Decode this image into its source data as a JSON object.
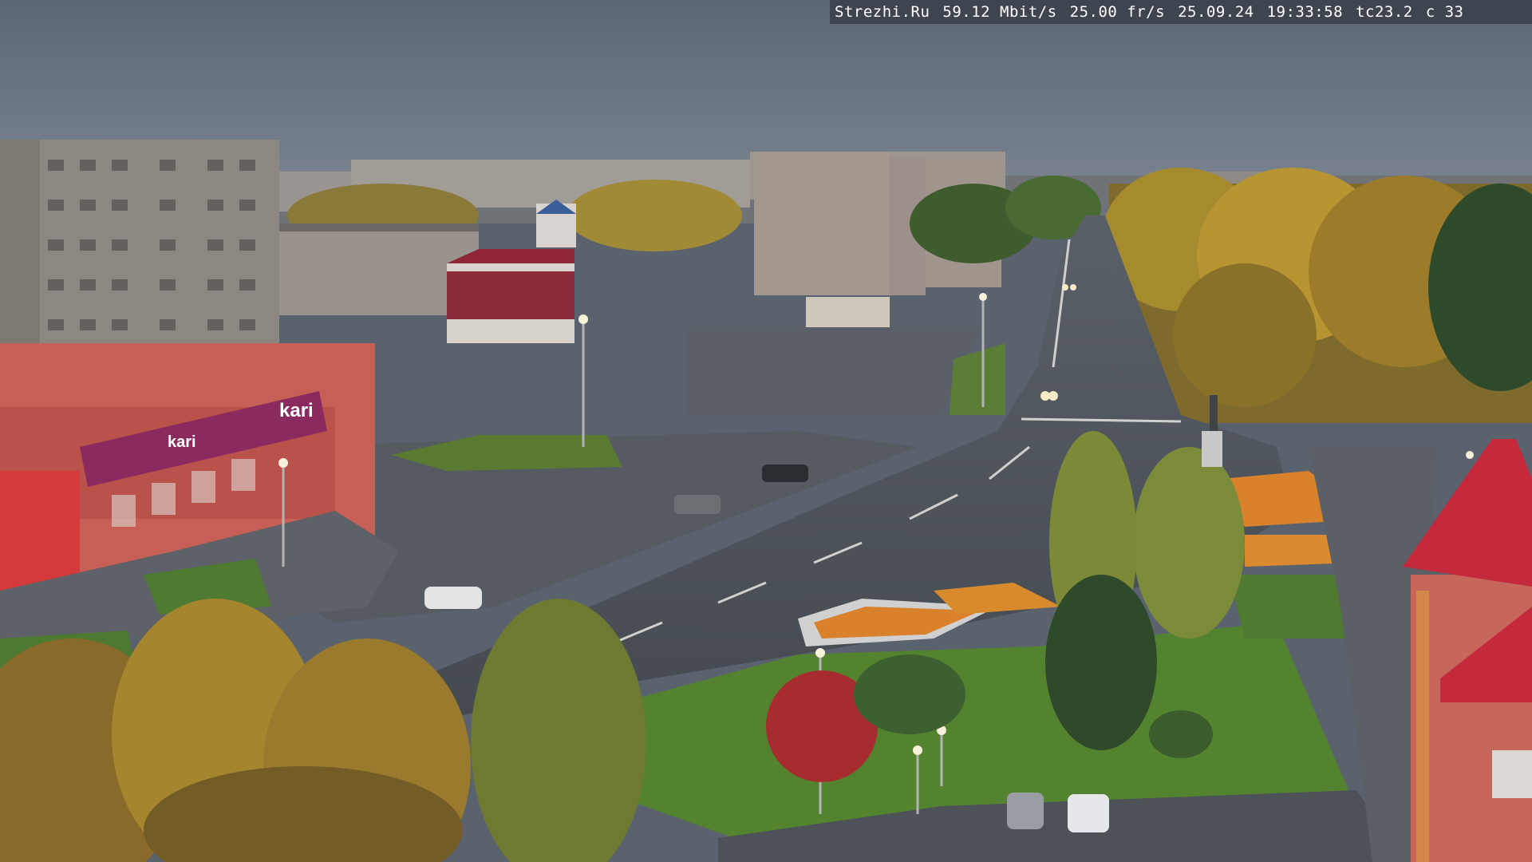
{
  "overlay": {
    "site": "Strezhi.Ru",
    "bitrate": "59.12 Mbit/s",
    "framerate": "25.00 fr/s",
    "date": "25.09.24",
    "time": "19:33:58",
    "camera": "tc23.2",
    "counter": "c 33"
  },
  "store": {
    "sign_main": "kari",
    "sign_sub": "kari"
  },
  "colors": {
    "sky": "#66707f",
    "asphalt": "#4e545c",
    "grass": "#4f7a34",
    "building": "#8a8580",
    "store_front": "#c7564c",
    "store_sign": "#8b2a5e",
    "roof_red": "#c42a3c",
    "autumn": "#b98a2f",
    "flowers": "#d9822b"
  }
}
